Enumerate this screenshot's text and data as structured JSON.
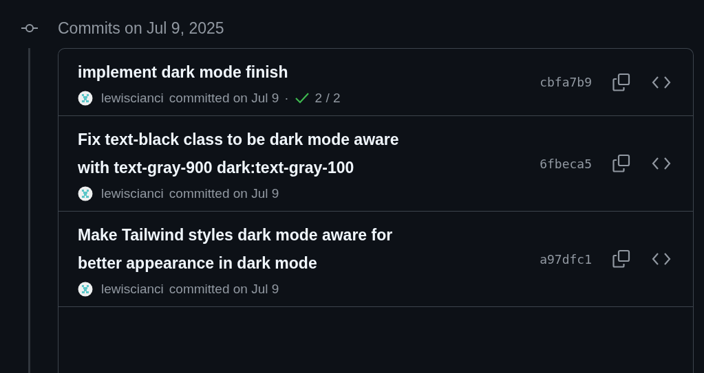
{
  "group": {
    "title": "Commits on Jul 9, 2025"
  },
  "commits": [
    {
      "title": "implement dark mode finish",
      "author": "lewiscianci",
      "meta": "committed on Jul 9",
      "separator": "·",
      "checks": {
        "passed": true,
        "count": "2 / 2"
      },
      "sha": "cbfa7b9"
    },
    {
      "title": "Fix text-black class to be dark mode aware with text-gray-900 dark:text-gray-100",
      "author": "lewiscianci",
      "meta": "committed on Jul 9",
      "sha": "6fbeca5"
    },
    {
      "title": "Make Tailwind styles dark mode aware for better appearance in dark mode",
      "author": "lewiscianci",
      "meta": "committed on Jul 9",
      "sha": "a97dfc1"
    }
  ]
}
